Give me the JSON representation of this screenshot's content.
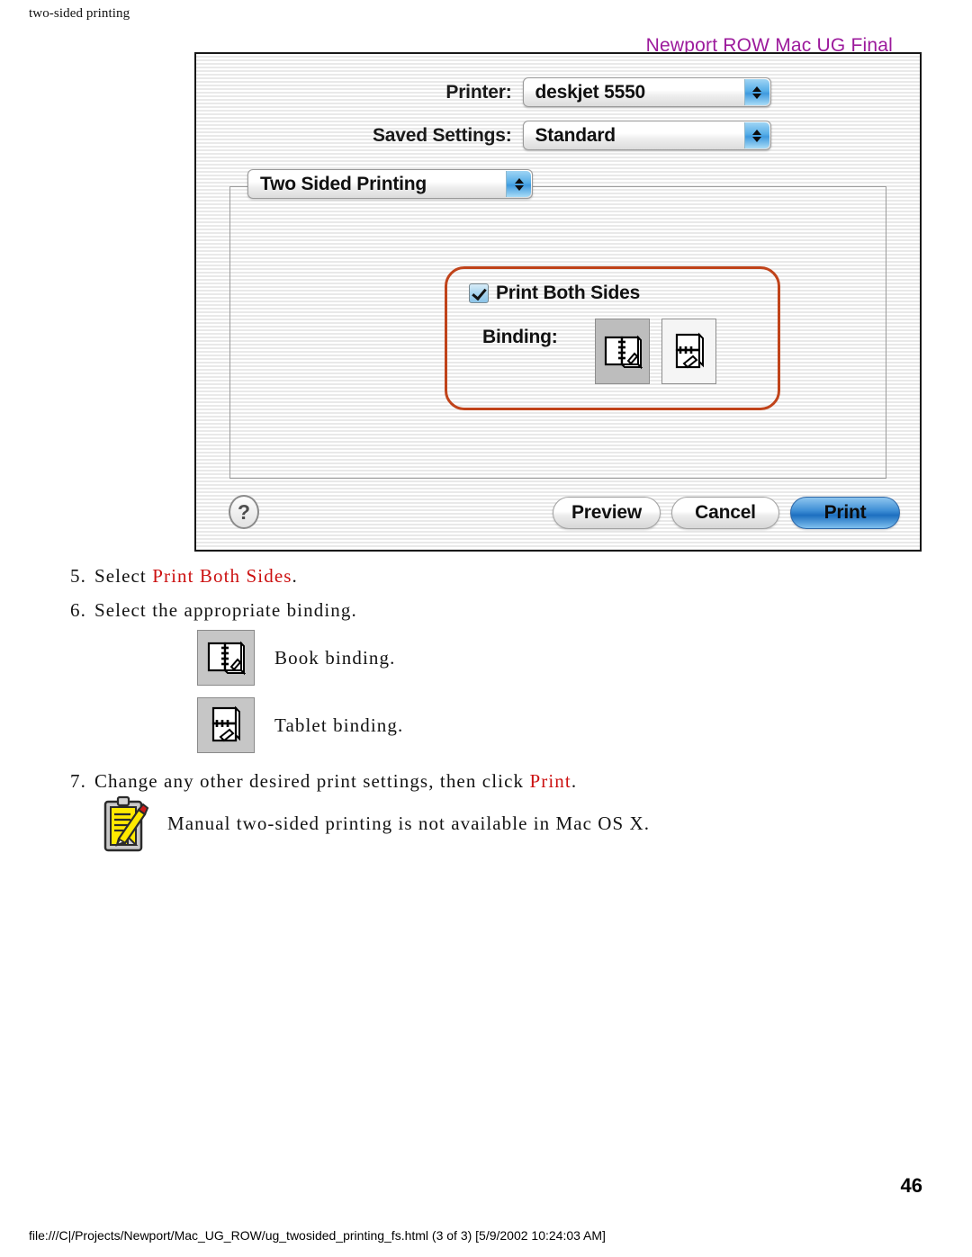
{
  "page": {
    "running_head": "two-sided printing",
    "watermark": "Newport ROW Mac UG Final",
    "page_number": "46",
    "footer": "file:///C|/Projects/Newport/Mac_UG_ROW/ug_twosided_printing_fs.html (3 of 3) [5/9/2002 10:24:03 AM]"
  },
  "dialog": {
    "printer_label": "Printer:",
    "printer_value": "deskjet 5550",
    "saved_settings_label": "Saved Settings:",
    "saved_settings_value": "Standard",
    "panel_value": "Two Sided Printing",
    "print_both_sides_label": "Print Both Sides",
    "print_both_sides_checked": "true",
    "binding_label": "Binding:",
    "binding_book_icon": "book-binding-icon",
    "binding_tablet_icon": "tablet-binding-icon",
    "binding_selected": "book",
    "help_label": "?",
    "preview_label": "Preview",
    "cancel_label": "Cancel",
    "print_label": "Print",
    "callout_color": "#c0431a",
    "default_button_color": "#1d6fc0"
  },
  "instructions": {
    "step5": {
      "num": "5.",
      "text_before": "Select ",
      "highlight": "Print Both Sides",
      "text_after": "."
    },
    "step6": {
      "num": "6.",
      "text": "Select the appropriate binding."
    },
    "book_caption": "Book binding.",
    "tablet_caption": "Tablet binding.",
    "step7": {
      "num": "7.",
      "text_before": "Change any other desired print settings, then click ",
      "highlight": "Print",
      "text_after": "."
    },
    "note": {
      "icon": "note-clipboard-icon",
      "text": "Manual two-sided printing is not available in Mac OS X."
    }
  }
}
